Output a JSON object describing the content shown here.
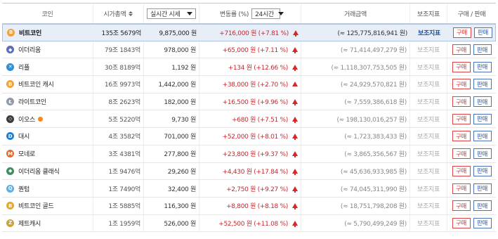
{
  "header": {
    "coin": "코인",
    "market_cap": "시가총액",
    "price_select": "실시간 시세",
    "change": "변동률 (%)",
    "period_select": "24시간",
    "volume": "거래금액",
    "sub_indicator": "보조지표",
    "trade": "구매 / 판매"
  },
  "buttons": {
    "buy": "구매",
    "sell": "판매"
  },
  "sub_label": "보조지표",
  "rows": [
    {
      "name": "비트코인",
      "cap": "135조 5679억",
      "price": "9,875,000 원",
      "change": "+716,000 원 (+7.81 %)",
      "volume": "(≈ 125,775,816,941 원)",
      "color": "#f2a23b",
      "glyph": "B"
    },
    {
      "name": "이더리움",
      "cap": "79조 1843억",
      "price": "978,000 원",
      "change": "+65,000 원 (+7.11 %)",
      "volume": "(≈ 71,414,497,279 원)",
      "color": "#5c6bc0",
      "glyph": "◆"
    },
    {
      "name": "리플",
      "cap": "30조 8189억",
      "price": "1,192 원",
      "change": "+134 원 (+12.66 %)",
      "volume": "(≈ 1,118,307,753,505 원)",
      "color": "#2f8fd8",
      "glyph": "✕"
    },
    {
      "name": "비트코인 캐시",
      "cap": "16조 9973억",
      "price": "1,442,000 원",
      "change": "+38,000 원 (+2.70 %)",
      "volume": "(≈ 24,929,570,821 원)",
      "color": "#f4a13a",
      "glyph": "B"
    },
    {
      "name": "라이트코인",
      "cap": "8조 2623억",
      "price": "182,000 원",
      "change": "+16,500 원 (+9.96 %)",
      "volume": "(≈ 7,559,386,618 원)",
      "color": "#8e9aa8",
      "glyph": "Ł"
    },
    {
      "name": "이오스",
      "cap": "5조 5220억",
      "price": "9,730 원",
      "change": "+680 원 (+7.51 %)",
      "volume": "(≈ 198,130,016,257 원)",
      "color": "#3a3a3a",
      "glyph": "◇"
    },
    {
      "name": "대시",
      "cap": "4조 3582억",
      "price": "701,000 원",
      "change": "+52,000 원 (+8.01 %)",
      "volume": "(≈ 1,723,383,433 원)",
      "color": "#1f7ed0",
      "glyph": "D"
    },
    {
      "name": "모네로",
      "cap": "3조 4381억",
      "price": "277,800 원",
      "change": "+23,800 원 (+9.37 %)",
      "volume": "(≈ 3,865,356,567 원)",
      "color": "#f26822",
      "glyph": "M"
    },
    {
      "name": "이더리움 클래식",
      "cap": "1조 9476억",
      "price": "29,260 원",
      "change": "+4,430 원 (+17.84 %)",
      "volume": "(≈ 45,636,933,985 원)",
      "color": "#3e8e5e",
      "glyph": "◆"
    },
    {
      "name": "퀀텀",
      "cap": "1조 7490억",
      "price": "32,400 원",
      "change": "+2,750 원 (+9.27 %)",
      "volume": "(≈ 74,045,311,990 원)",
      "color": "#5ab0e8",
      "glyph": "Q"
    },
    {
      "name": "비트코인 골드",
      "cap": "1조 5885억",
      "price": "116,300 원",
      "change": "+8,800 원 (+8.18 %)",
      "volume": "(≈ 18,751,798,208 원)",
      "color": "#e8a820",
      "glyph": "B"
    },
    {
      "name": "제트캐시",
      "cap": "1조 1959억",
      "price": "526,000 원",
      "change": "+52,500 원 (+11.08 %)",
      "volume": "(≈ 5,790,499,249 원)",
      "color": "#c9a43a",
      "glyph": "Z"
    }
  ]
}
